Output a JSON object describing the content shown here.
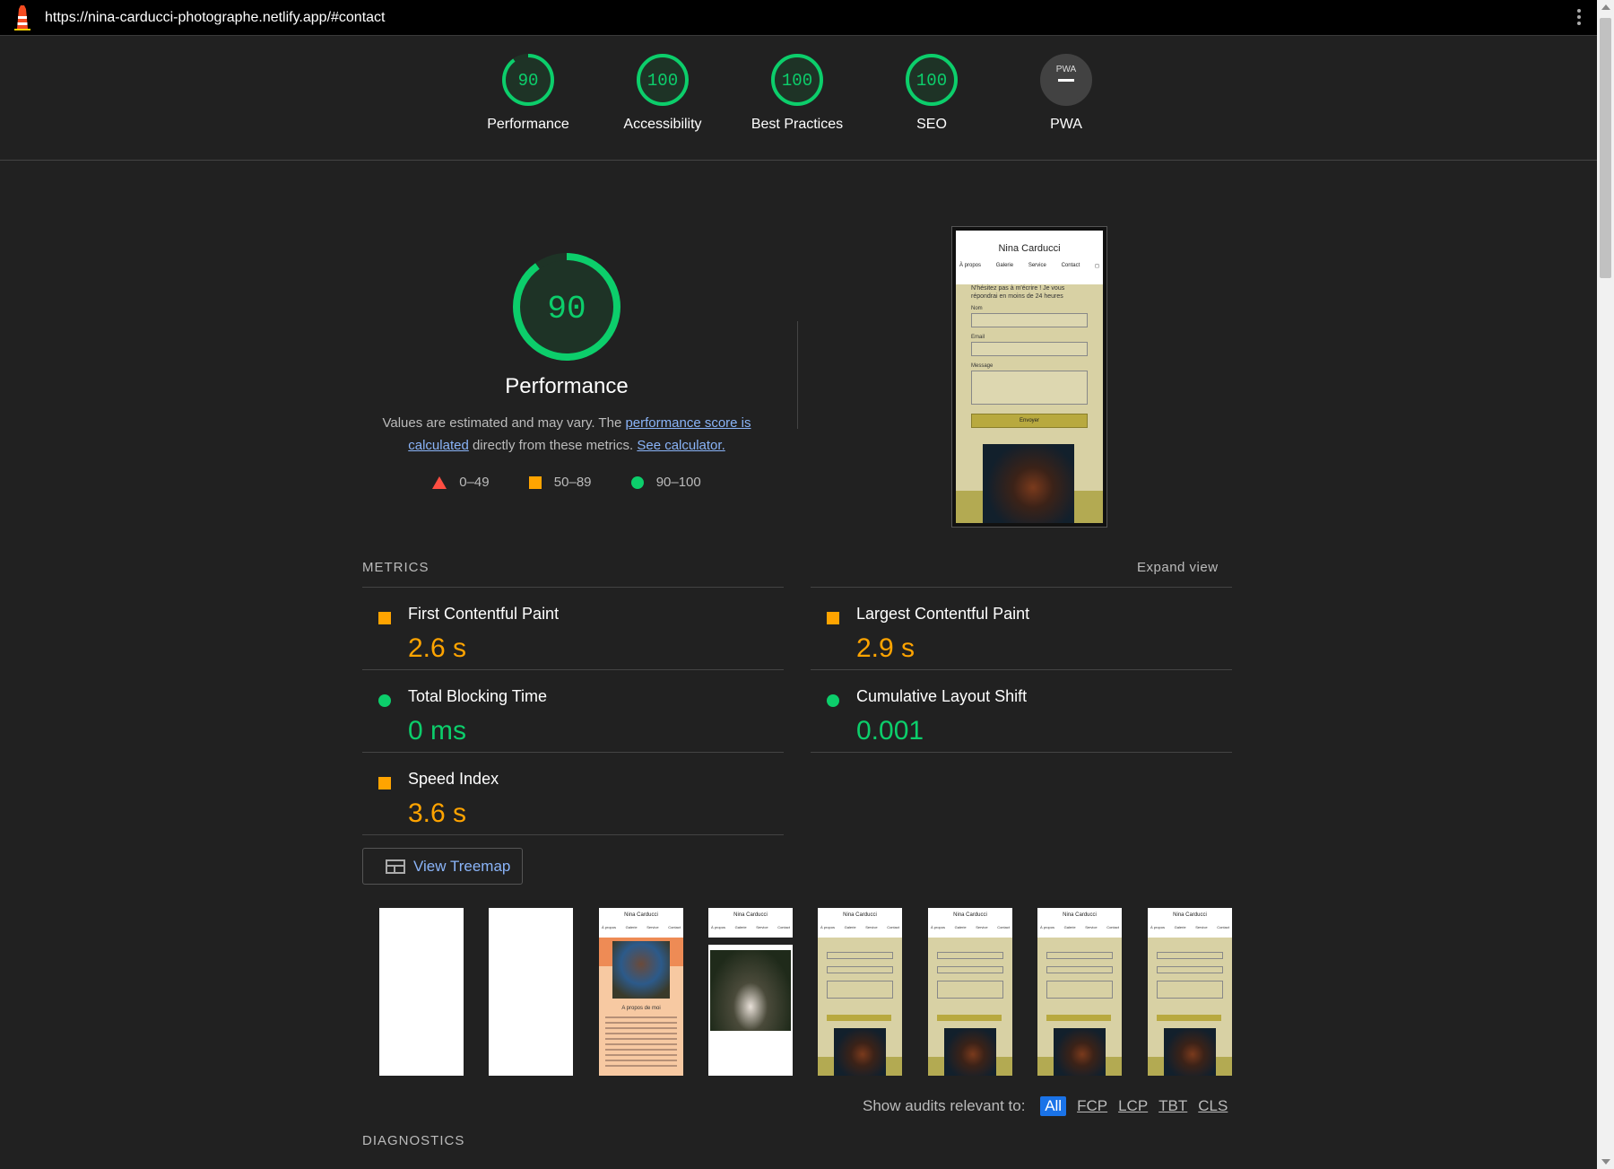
{
  "window": {
    "url": "https://nina-carducci-photographe.netlify.app/#contact",
    "logo_icon": "lighthouse-icon",
    "menu_icon": "kebab-menu-icon"
  },
  "categories": [
    {
      "label": "Performance",
      "score": "90",
      "fraction": 0.9,
      "color": "#0cce6b"
    },
    {
      "label": "Accessibility",
      "score": "100",
      "fraction": 1.0,
      "color": "#0cce6b"
    },
    {
      "label": "Best Practices",
      "score": "100",
      "fraction": 1.0,
      "color": "#0cce6b"
    },
    {
      "label": "SEO",
      "score": "100",
      "fraction": 1.0,
      "color": "#0cce6b"
    },
    {
      "label": "PWA",
      "score": "",
      "badge": "PWA",
      "fraction": 0,
      "color": "#888888"
    }
  ],
  "performance": {
    "score": "90",
    "title": "Performance",
    "desc_prefix": "Values are estimated and may vary. The ",
    "desc_link": "performance score is calculated",
    "desc_mid": " directly from these metrics. ",
    "calculator_link": "See calculator.",
    "legend": [
      {
        "shape": "triangle",
        "range": "0–49",
        "color": "#ff4e42"
      },
      {
        "shape": "square",
        "range": "50–89",
        "color": "#ffa400"
      },
      {
        "shape": "circle",
        "range": "90–100",
        "color": "#0cce6b"
      }
    ]
  },
  "screenshot": {
    "site_name": "Nina Carducci",
    "nav": [
      "À propos",
      "Galerie",
      "Service",
      "Contact"
    ],
    "intro": "N'hésitez pas à m'écrire ! Je vous répondrai en moins de 24 heures",
    "fields": [
      "Nom",
      "Email",
      "Message"
    ],
    "submit": "Envoyer"
  },
  "metrics": {
    "header": "METRICS",
    "expand": "Expand view",
    "items": [
      {
        "label": "First Contentful Paint",
        "value": "2.6 s",
        "rating": "average"
      },
      {
        "label": "Largest Contentful Paint",
        "value": "2.9 s",
        "rating": "average"
      },
      {
        "label": "Total Blocking Time",
        "value": "0 ms",
        "rating": "pass"
      },
      {
        "label": "Cumulative Layout Shift",
        "value": "0.001",
        "rating": "pass"
      },
      {
        "label": "Speed Index",
        "value": "3.6 s",
        "rating": "average"
      }
    ]
  },
  "treemap": {
    "label": "View Treemap",
    "icon": "treemap-icon"
  },
  "filmstrip": {
    "site_name": "Nina Carducci",
    "about_title": "A propos de moi",
    "frame_types": [
      "blank",
      "blank",
      "about",
      "gallery",
      "contact",
      "contact",
      "contact",
      "contact"
    ]
  },
  "audit_filter": {
    "label": "Show audits relevant to:",
    "options": [
      "All",
      "FCP",
      "LCP",
      "TBT",
      "CLS"
    ],
    "active": "All"
  },
  "diagnostics": {
    "header": "DIAGNOSTICS"
  }
}
